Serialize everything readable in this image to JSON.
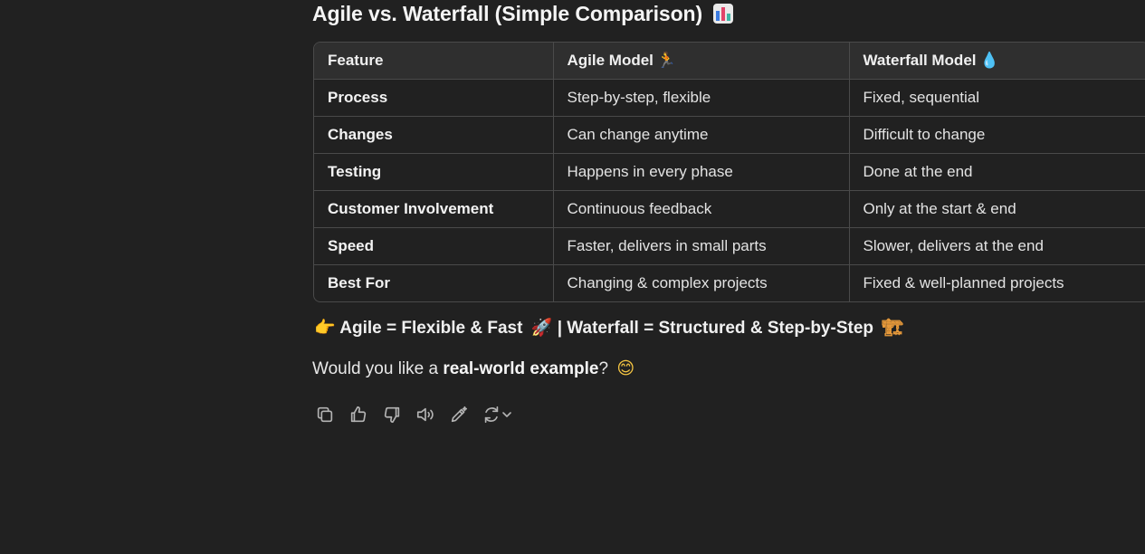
{
  "heading": {
    "title": "Agile vs. Waterfall (Simple Comparison)",
    "emoji_icon": "bar-chart-emoji"
  },
  "table": {
    "headers": [
      {
        "label": "Feature",
        "emoji": ""
      },
      {
        "label": "Agile Model",
        "emoji": "🏃"
      },
      {
        "label": "Waterfall Model",
        "emoji": "💧"
      }
    ],
    "rows": [
      {
        "feature": "Process",
        "agile": "Step-by-step, flexible",
        "waterfall": "Fixed, sequential"
      },
      {
        "feature": "Changes",
        "agile": "Can change anytime",
        "waterfall": "Difficult to change"
      },
      {
        "feature": "Testing",
        "agile": "Happens in every phase",
        "waterfall": "Done at the end"
      },
      {
        "feature": "Customer Involvement",
        "agile": "Continuous feedback",
        "waterfall": "Only at the start & end"
      },
      {
        "feature": "Speed",
        "agile": "Faster, delivers in small parts",
        "waterfall": "Slower, delivers at the end"
      },
      {
        "feature": "Best For",
        "agile": "Changing & complex projects",
        "waterfall": "Fixed & well-planned projects"
      }
    ]
  },
  "summary": {
    "pointer_emoji": "👉",
    "agile_text": "Agile = Flexible & Fast",
    "rocket_emoji": "🚀",
    "waterfall_text": "| Waterfall = Structured & Step-by-Step",
    "construction_emoji": "🏗"
  },
  "question": {
    "prefix": "Would you like a ",
    "bold": "real-world example",
    "suffix": "?",
    "emoji": "😊"
  },
  "actions": [
    {
      "name": "copy-icon"
    },
    {
      "name": "thumbs-up-icon"
    },
    {
      "name": "thumbs-down-icon"
    },
    {
      "name": "read-aloud-icon"
    },
    {
      "name": "edit-icon"
    },
    {
      "name": "regenerate-icon"
    }
  ],
  "colors": {
    "background": "#212121",
    "table_header_bg": "#2f2f2f",
    "border": "#4a4a4a",
    "text": "#ececec"
  }
}
